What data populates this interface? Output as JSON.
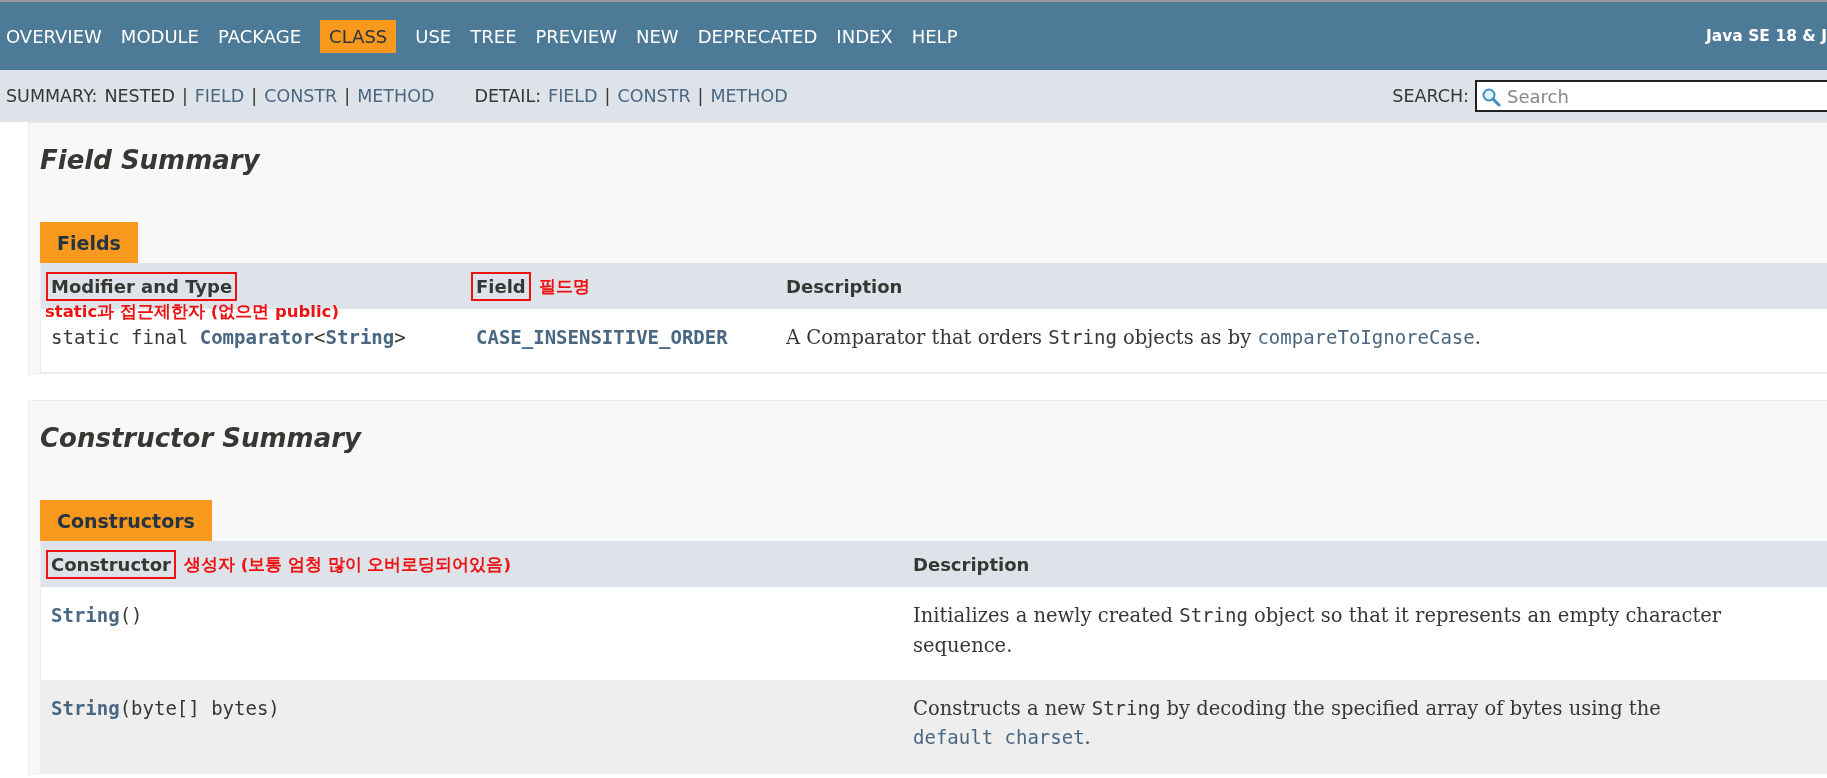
{
  "top_nav": {
    "items": [
      {
        "label": "OVERVIEW",
        "selected": false
      },
      {
        "label": "MODULE",
        "selected": false
      },
      {
        "label": "PACKAGE",
        "selected": false
      },
      {
        "label": "CLASS",
        "selected": true
      },
      {
        "label": "USE",
        "selected": false
      },
      {
        "label": "TREE",
        "selected": false
      },
      {
        "label": "PREVIEW",
        "selected": false
      },
      {
        "label": "NEW",
        "selected": false
      },
      {
        "label": "DEPRECATED",
        "selected": false
      },
      {
        "label": "INDEX",
        "selected": false
      },
      {
        "label": "HELP",
        "selected": false
      }
    ],
    "title": "Java SE 18 & J"
  },
  "sub_nav": {
    "separator": "|",
    "groups": [
      {
        "label": "SUMMARY:",
        "items": [
          {
            "label": "NESTED",
            "link": false
          },
          {
            "label": "FIELD",
            "link": true
          },
          {
            "label": "CONSTR",
            "link": true
          },
          {
            "label": "METHOD",
            "link": true
          }
        ]
      },
      {
        "label": "DETAIL:",
        "items": [
          {
            "label": "FIELD",
            "link": true
          },
          {
            "label": "CONSTR",
            "link": true
          },
          {
            "label": "METHOD",
            "link": true
          }
        ]
      }
    ],
    "search": {
      "label": "SEARCH:",
      "placeholder": "Search"
    }
  },
  "sections": [
    {
      "title": "Field Summary",
      "tab": "Fields",
      "columns": [
        {
          "label": "Modifier and Type",
          "highlighted": true,
          "annotation": {
            "text": "static과 접근제한자 (없으면 public)",
            "kind": "below"
          }
        },
        {
          "label": "Field",
          "highlighted": true,
          "annotation": {
            "text": "필드명",
            "kind": "beside"
          }
        },
        {
          "label": "Description",
          "highlighted": false
        }
      ],
      "rows": [
        {
          "cells": [
            [
              {
                "kind": "mono",
                "text": "static final "
              },
              {
                "kind": "mono-link",
                "text": "Comparator"
              },
              {
                "kind": "mono",
                "text": "<"
              },
              {
                "kind": "mono-link",
                "text": "String"
              },
              {
                "kind": "mono",
                "text": ">"
              }
            ],
            [
              {
                "kind": "mono-link",
                "text": "CASE_INSENSITIVE_ORDER"
              }
            ],
            [
              {
                "kind": "text",
                "text": "A Comparator that orders "
              },
              {
                "kind": "mono",
                "text": "String"
              },
              {
                "kind": "text",
                "text": " objects as by "
              },
              {
                "kind": "mono-ref",
                "text": "compareToIgnoreCase"
              },
              {
                "kind": "text",
                "text": "."
              }
            ]
          ]
        }
      ]
    },
    {
      "title": "Constructor Summary",
      "tab": "Constructors",
      "columns": [
        {
          "label": "Constructor",
          "highlighted": true,
          "annotation": {
            "text": "생성자 (보통 엄청 많이 오버로딩되어있음)",
            "kind": "beside"
          }
        },
        {
          "label": "Description",
          "highlighted": false
        }
      ],
      "rows": [
        {
          "cells": [
            [
              {
                "kind": "mono-link",
                "text": "String"
              },
              {
                "kind": "mono",
                "text": "()"
              }
            ],
            [
              {
                "kind": "text",
                "text": "Initializes a newly created "
              },
              {
                "kind": "mono",
                "text": "String"
              },
              {
                "kind": "text",
                "text": " object so that it represents an empty character sequence."
              }
            ]
          ]
        },
        {
          "cells": [
            [
              {
                "kind": "mono-link",
                "text": "String"
              },
              {
                "kind": "mono",
                "text": "(byte[] bytes)"
              }
            ],
            [
              {
                "kind": "text",
                "text": "Constructs a new "
              },
              {
                "kind": "mono",
                "text": "String"
              },
              {
                "kind": "text",
                "text": " by decoding the specified array of bytes using the "
              },
              {
                "kind": "mono-ref",
                "text": "default charset"
              },
              {
                "kind": "text",
                "text": "."
              }
            ]
          ]
        }
      ]
    }
  ]
}
